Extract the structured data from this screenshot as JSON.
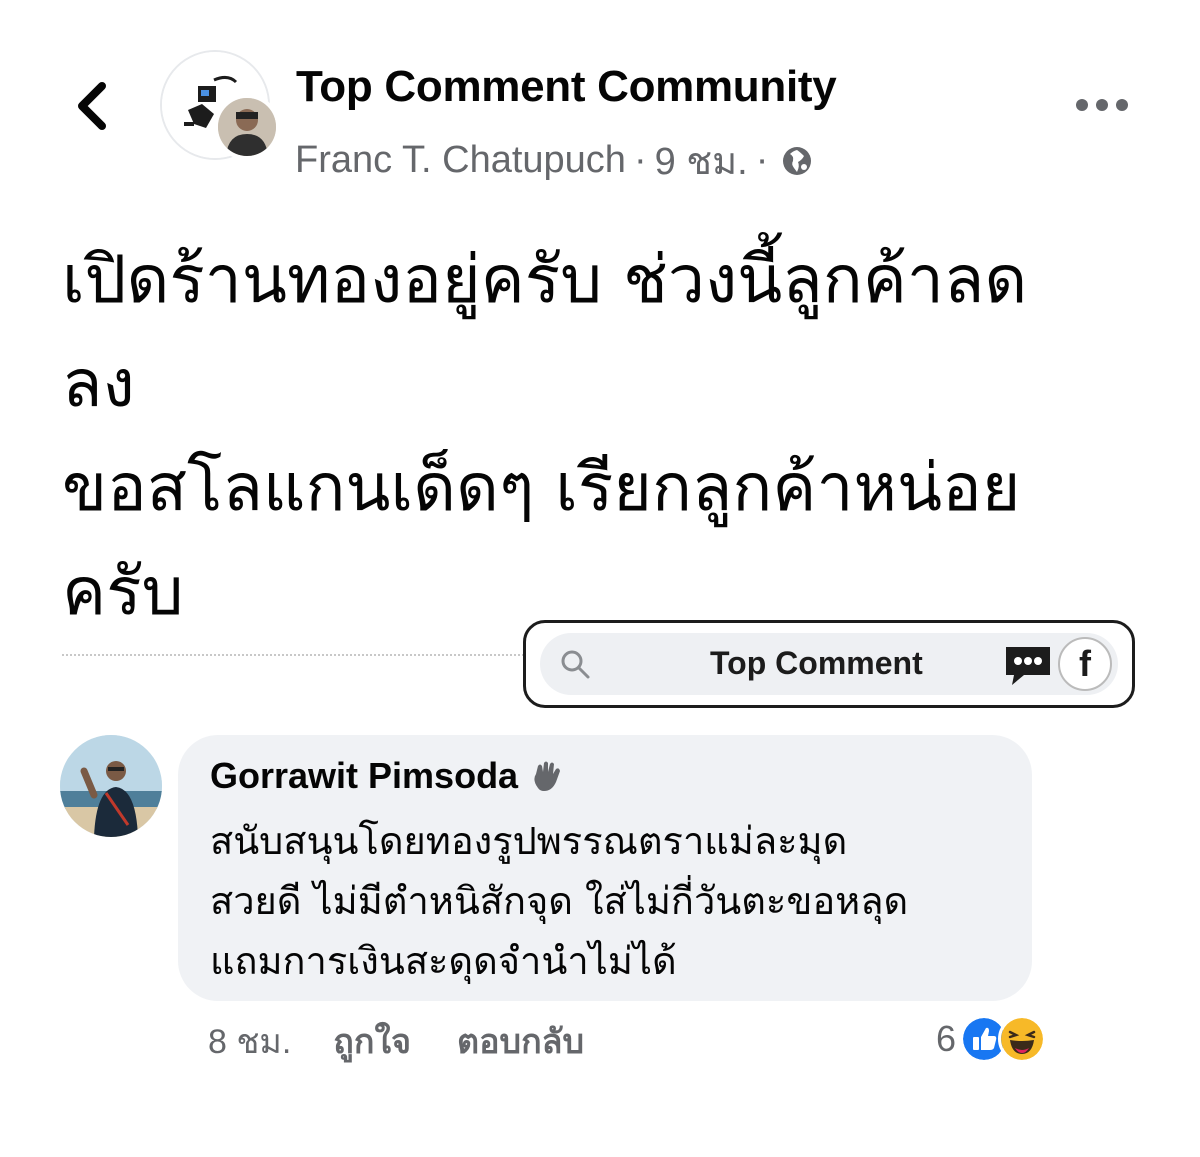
{
  "header": {
    "group_name": "Top Comment Community",
    "author_name": "Franc T. Chatupuch",
    "separator": "·",
    "time": "9 ชม.",
    "icons": {
      "back": "chevron-left-icon",
      "more": "more-dots-icon",
      "privacy": "globe-icon"
    }
  },
  "post": {
    "text": "เปิดร้านทองอยู่ครับ ช่วงนี้ลูกค้าลด\nลง\nขอสโลแกนเด็ดๆ เรียกลูกค้าหน่อย\nครับ"
  },
  "watermark": {
    "label": "Top Comment",
    "fb_letter": "f",
    "icons": [
      "search-icon",
      "chat-bubble-icon",
      "facebook-icon"
    ]
  },
  "comment": {
    "author": "Gorrawit Pimsoda",
    "badge_icon": "wave-hand-icon",
    "text": "สนับสนุนโดยทองรูปพรรณตราแม่ละมุด\nสวยดี ไม่มีตำหนิสักจุด ใส่ไม่กี่วันตะขอหลุด\nแถมการเงินสะดุดจำนำไม่ได้",
    "time": "8 ชม.",
    "like_label": "ถูกใจ",
    "reply_label": "ตอบกลับ",
    "reaction_count": "6",
    "reactions": [
      "like-icon",
      "haha-icon"
    ]
  },
  "colors": {
    "primary_text": "#050505",
    "secondary_text": "#65676b",
    "bubble_bg": "#f0f2f5",
    "like_blue": "#1877f2",
    "haha_yellow": "#f7b928"
  }
}
